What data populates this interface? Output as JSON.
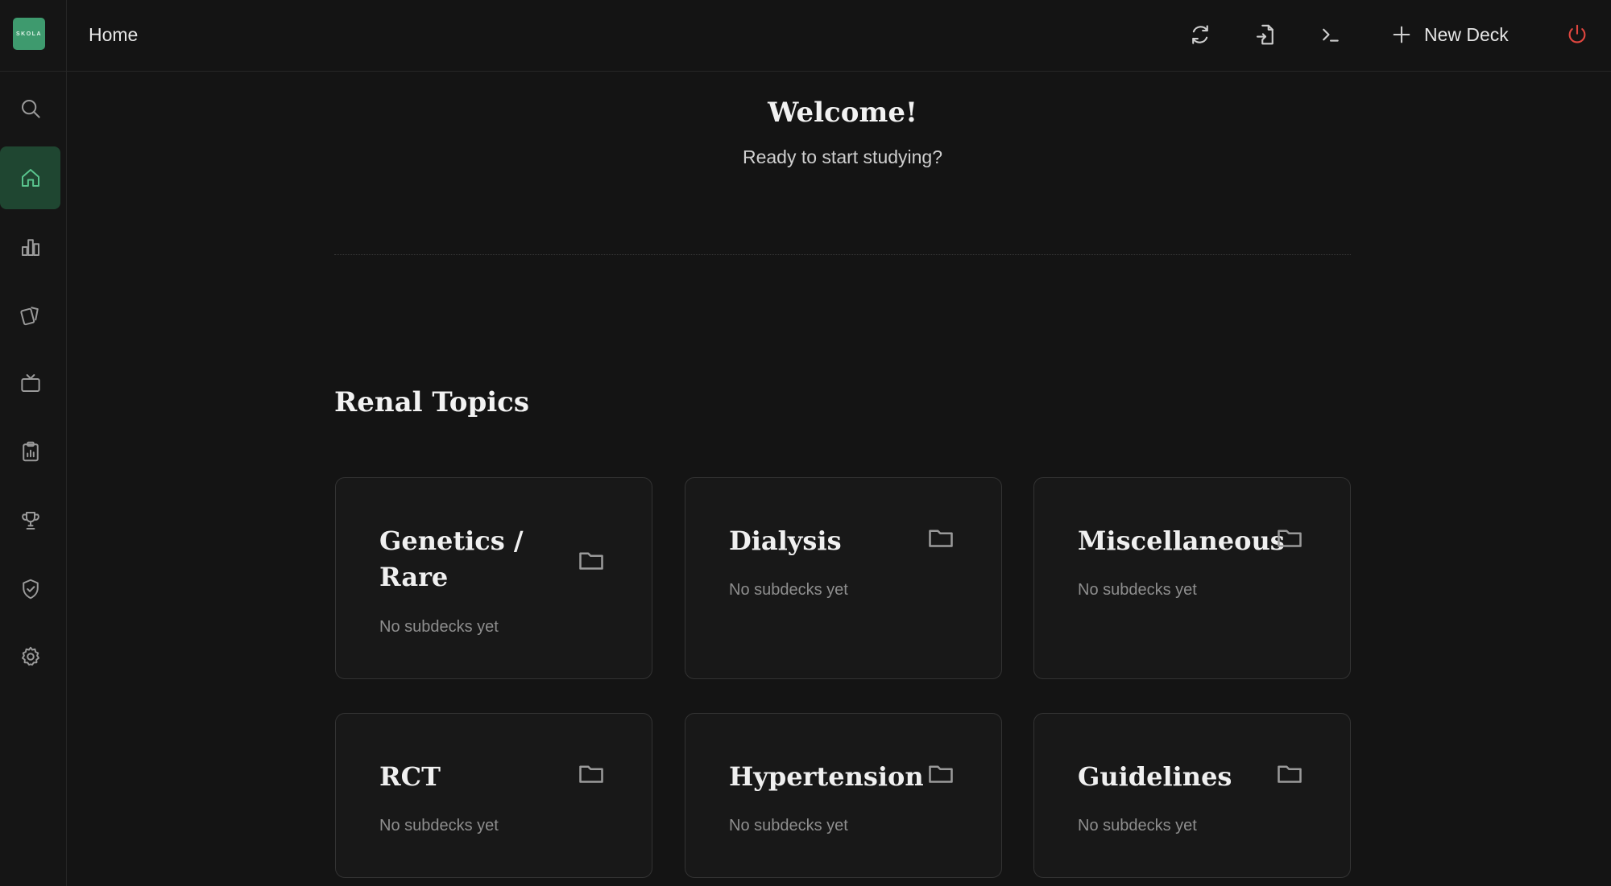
{
  "app": {
    "logo_text": "SKOLA"
  },
  "header": {
    "title": "Home",
    "new_deck_label": "New Deck"
  },
  "sidebar": {
    "items": [
      {
        "name": "search",
        "icon": "search-icon",
        "active": false
      },
      {
        "name": "home",
        "icon": "home-icon",
        "active": true
      },
      {
        "name": "stats",
        "icon": "bar-chart-icon",
        "active": false
      },
      {
        "name": "cards",
        "icon": "cards-icon",
        "active": false
      },
      {
        "name": "media",
        "icon": "tv-icon",
        "active": false
      },
      {
        "name": "reports",
        "icon": "clipboard-chart-icon",
        "active": false
      },
      {
        "name": "achievements",
        "icon": "trophy-icon",
        "active": false
      },
      {
        "name": "security",
        "icon": "shield-check-icon",
        "active": false
      },
      {
        "name": "settings",
        "icon": "gear-icon",
        "active": false
      }
    ]
  },
  "welcome": {
    "title": "Welcome!",
    "subtitle": "Ready to start studying?"
  },
  "section": {
    "title": "Renal Topics",
    "decks": [
      {
        "title": "Genetics / Rare",
        "subtitle": "No subdecks yet"
      },
      {
        "title": "Dialysis",
        "subtitle": "No subdecks yet"
      },
      {
        "title": "Miscellaneous",
        "subtitle": "No subdecks yet"
      },
      {
        "title": "RCT",
        "subtitle": "No subdecks yet"
      },
      {
        "title": "Hypertension",
        "subtitle": "No subdecks yet"
      },
      {
        "title": "Guidelines",
        "subtitle": "No subdecks yet"
      }
    ]
  },
  "colors": {
    "background": "#141414",
    "accent": "#59c48d",
    "active_bg": "#1f4631",
    "power": "#e0463f",
    "logo": "#3e9a6e"
  }
}
